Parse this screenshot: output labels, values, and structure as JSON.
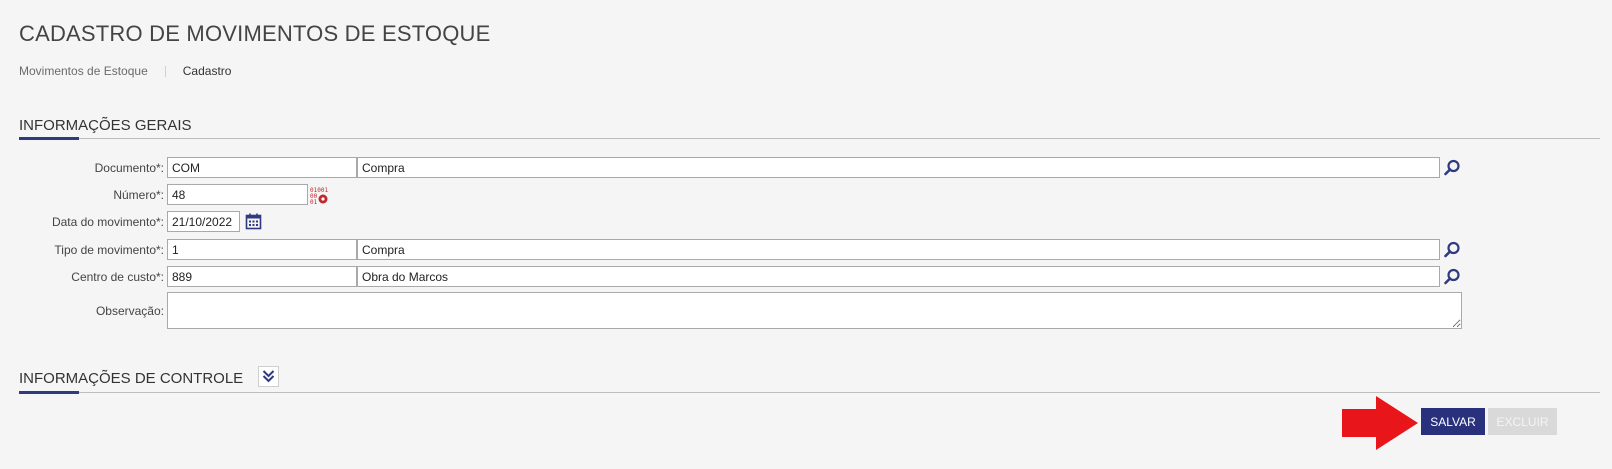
{
  "page": {
    "title": "CADASTRO DE MOVIMENTOS DE ESTOQUE"
  },
  "breadcrumb": {
    "parent": "Movimentos de Estoque",
    "current": "Cadastro"
  },
  "sections": {
    "general": "INFORMAÇÕES GERAIS",
    "control": "INFORMAÇÕES DE CONTROLE"
  },
  "form": {
    "documento": {
      "label": "Documento*:",
      "code": "COM",
      "description": "Compra"
    },
    "numero": {
      "label": "Número*:",
      "value": "48"
    },
    "data": {
      "label": "Data do movimento*:",
      "value": "21/10/2022"
    },
    "tipo": {
      "label": "Tipo de movimento*:",
      "code": "1",
      "description": "Compra"
    },
    "centro": {
      "label": "Centro de custo*:",
      "code": "889",
      "description": "Obra do Marcos"
    },
    "observacao": {
      "label": "Observação:",
      "value": ""
    }
  },
  "actions": {
    "save": "SALVAR",
    "delete": "EXCLUIR"
  },
  "icons": {
    "search": "search-icon",
    "number_generator": "number-generator-icon",
    "calendar": "calendar-icon",
    "expand": "double-chevron-down-icon",
    "pointer_arrow": "arrow-right-icon"
  },
  "colors": {
    "accent": "#2f3a80",
    "save_button": "#29317c",
    "delete_button_disabled": "#d9d9d9",
    "pointer_arrow": "#e8151a"
  }
}
